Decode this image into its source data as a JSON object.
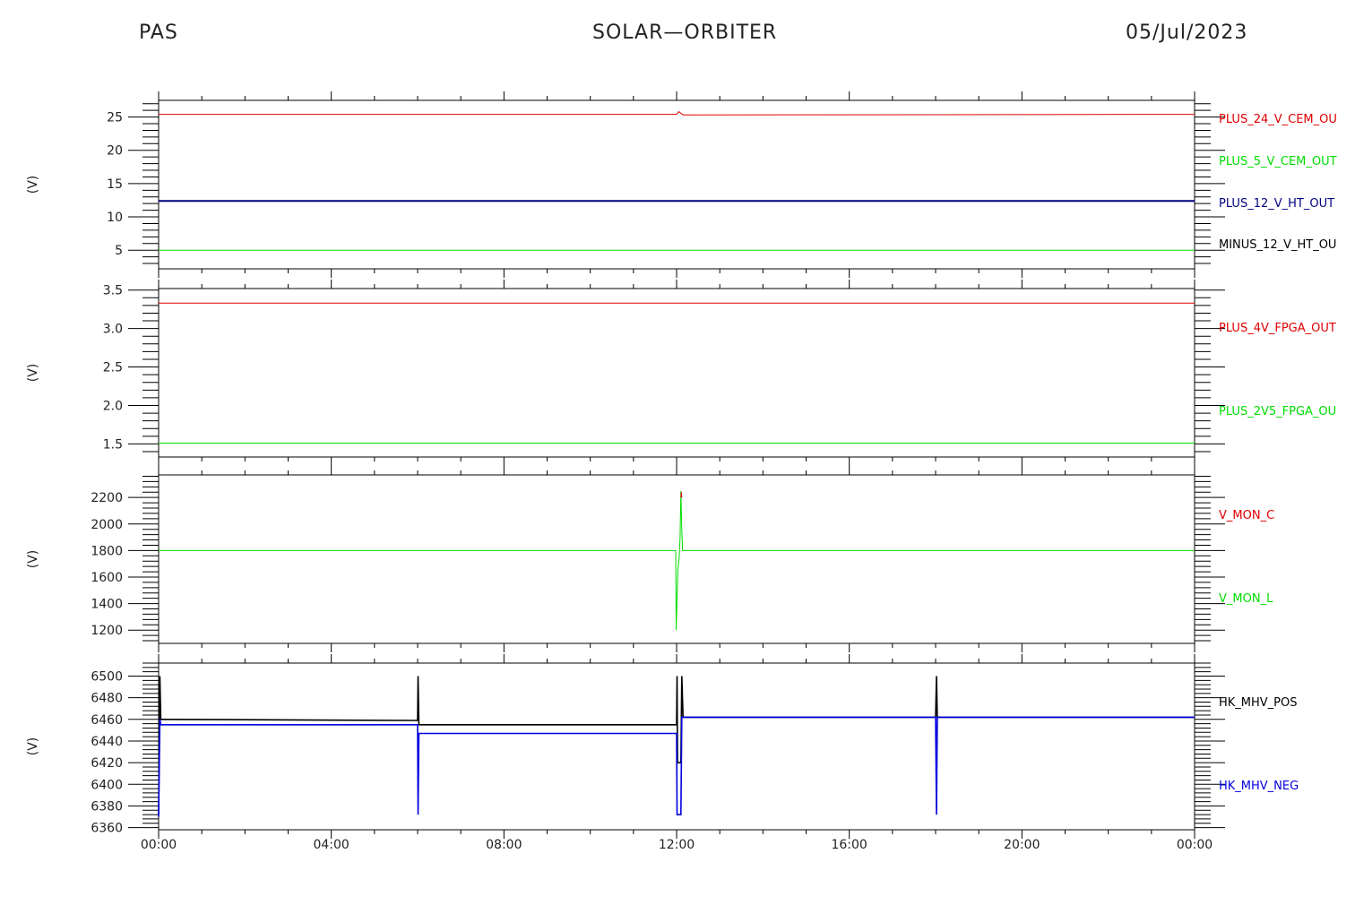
{
  "header": {
    "left": "PAS",
    "center": "SOLAR—ORBITER",
    "right": "05/Jul/2023"
  },
  "x_ticks": [
    "00:00",
    "04:00",
    "08:00",
    "12:00",
    "16:00",
    "20:00",
    "00:00"
  ],
  "colors": {
    "red": "#e00000",
    "green": "#00dd00",
    "navy": "#000080",
    "blue": "#0000e0",
    "black": "#000000"
  },
  "chart_data": [
    {
      "type": "line",
      "ylabel": "(V)",
      "ylim": [
        2.2,
        27.5
      ],
      "y_ticks": [
        5,
        10,
        15,
        20,
        25
      ],
      "x_unit": "hours",
      "xlim": [
        0,
        24
      ],
      "legend": [
        {
          "name": "PLUS_24_V_CEM_OU",
          "color": "#e00000"
        },
        {
          "name": "PLUS_5_V_CEM_OUT",
          "color": "#00dd00"
        },
        {
          "name": "PLUS_12_V_HT_OUT",
          "color": "#000080"
        },
        {
          "name": "MINUS_12_V_HT_OU",
          "color": "#000000"
        }
      ],
      "series": [
        {
          "name": "PLUS_24_V_CEM_OU",
          "color": "#e00000",
          "width": 1,
          "x": [
            0,
            12.0,
            12.05,
            12.15,
            24
          ],
          "y": [
            25.4,
            25.4,
            25.8,
            25.3,
            25.4
          ]
        },
        {
          "name": "PLUS_12_V_HT_OUT",
          "color": "#000080",
          "width": 2,
          "x": [
            0,
            24
          ],
          "y": [
            12.4,
            12.4
          ]
        },
        {
          "name": "PLUS_5_V_CEM_OUT",
          "color": "#00dd00",
          "width": 1,
          "x": [
            0,
            24
          ],
          "y": [
            5.0,
            5.0
          ]
        }
      ]
    },
    {
      "type": "line",
      "ylabel": "(V)",
      "ylim": [
        1.33,
        3.52
      ],
      "y_ticks": [
        1.5,
        2.0,
        2.5,
        3.0,
        3.5
      ],
      "y_tick_labels": [
        "1.5",
        "2.0",
        "2.5",
        "3.0",
        "3.5"
      ],
      "x_unit": "hours",
      "xlim": [
        0,
        24
      ],
      "legend": [
        {
          "name": "PLUS_4V_FPGA_OUT",
          "color": "#e00000"
        },
        {
          "name": "PLUS_2V5_FPGA_OU",
          "color": "#00dd00"
        }
      ],
      "series": [
        {
          "name": "PLUS_4V_FPGA_OUT",
          "color": "#e00000",
          "width": 1,
          "x": [
            0,
            24
          ],
          "y": [
            3.33,
            3.33
          ]
        },
        {
          "name": "PLUS_2V5_FPGA_OU",
          "color": "#00dd00",
          "width": 1,
          "x": [
            0,
            24
          ],
          "y": [
            1.51,
            1.51
          ]
        }
      ]
    },
    {
      "type": "line",
      "ylabel": "(V)",
      "ylim": [
        1100,
        2370
      ],
      "y_ticks": [
        1200,
        1400,
        1600,
        1800,
        2000,
        2200
      ],
      "x_unit": "hours",
      "xlim": [
        0,
        24
      ],
      "legend": [
        {
          "name": "V_MON_C",
          "color": "#e00000"
        },
        {
          "name": "V_MON_L",
          "color": "#00dd00"
        }
      ],
      "series": [
        {
          "name": "V_MON_L",
          "color": "#00dd00",
          "width": 1,
          "x": [
            0,
            11.98,
            11.99,
            12.03,
            12.06,
            12.08,
            12.1,
            12.12,
            12.14,
            12.17,
            24
          ],
          "y": [
            1800,
            1800,
            1200,
            1650,
            1750,
            1900,
            2250,
            1950,
            1800,
            1800,
            1800
          ]
        },
        {
          "name": "V_MON_C",
          "color": "#e00000",
          "width": 1,
          "x": [
            12.1,
            12.11,
            12.12
          ],
          "y": [
            2200,
            2240,
            2200
          ]
        }
      ]
    },
    {
      "type": "line",
      "ylabel": "(V)",
      "ylim": [
        6358,
        6512
      ],
      "y_ticks": [
        6360,
        6380,
        6400,
        6420,
        6440,
        6460,
        6480,
        6500
      ],
      "x_unit": "hours",
      "xlim": [
        0,
        24
      ],
      "legend": [
        {
          "name": "HK_MHV_POS",
          "color": "#000000"
        },
        {
          "name": "HK_MHV_NEG",
          "color": "#0000e0"
        }
      ],
      "series": [
        {
          "name": "HK_MHV_POS",
          "color": "#000000",
          "width": 1.6,
          "x": [
            0,
            0.03,
            0.05,
            0.07,
            0.1,
            6.0,
            6.01,
            6.03,
            6.05,
            12.0,
            12.01,
            12.02,
            12.1,
            12.12,
            12.15,
            12.17,
            12.2,
            18.0,
            18.02,
            18.04,
            18.06,
            24
          ],
          "y": [
            6372,
            6500,
            6460,
            6460,
            6460,
            6459,
            6500,
            6455,
            6455,
            6455,
            6500,
            6420,
            6420,
            6500,
            6462,
            6462,
            6462,
            6462,
            6500,
            6462,
            6462,
            6462
          ]
        },
        {
          "name": "HK_MHV_NEG",
          "color": "#0000e0",
          "width": 1.6,
          "x": [
            0,
            0.03,
            0.05,
            0.1,
            6.0,
            6.01,
            6.03,
            6.05,
            12.0,
            12.01,
            12.03,
            12.1,
            12.12,
            12.15,
            12.2,
            18.0,
            18.02,
            18.04,
            18.06,
            24
          ],
          "y": [
            6370,
            6460,
            6455,
            6455,
            6455,
            6372,
            6447,
            6447,
            6447,
            6372,
            6372,
            6372,
            6462,
            6462,
            6462,
            6462,
            6372,
            6462,
            6462,
            6462
          ]
        }
      ]
    }
  ]
}
